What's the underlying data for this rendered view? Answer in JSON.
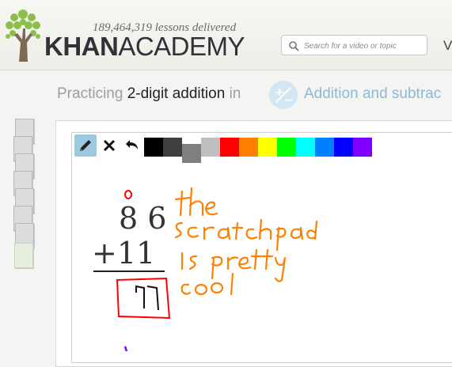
{
  "header": {
    "lessons_delivered": "189,464,319 lessons delivered",
    "logo_khan": "KHAN",
    "logo_academy": "ACADEMY",
    "search_placeholder": "Search for a video or topic",
    "nav_partial": "V"
  },
  "exercise": {
    "practicing_prefix": "Practicing",
    "exercise_name": "2-digit addition",
    "in_word": "in",
    "topic_name": "Addition and subtrac",
    "topic_icon": "plus-minus-icon"
  },
  "stack": {
    "cards": 8
  },
  "scratchpad": {
    "tools": [
      {
        "name": "pencil-icon",
        "selected": true
      },
      {
        "name": "clear-icon",
        "selected": false
      },
      {
        "name": "undo-icon",
        "selected": false
      }
    ],
    "colors": [
      "#000000",
      "#3f3f3f",
      "#7f7f7f",
      "#bfbfbf",
      "#ff0000",
      "#ff7f00",
      "#ffff00",
      "#00ff00",
      "#00ffff",
      "#007fff",
      "#0000ff",
      "#7f00ff"
    ],
    "selected_color": "#7f7f7f"
  },
  "problem": {
    "top_number": "8 6",
    "bottom_number": "+11"
  }
}
